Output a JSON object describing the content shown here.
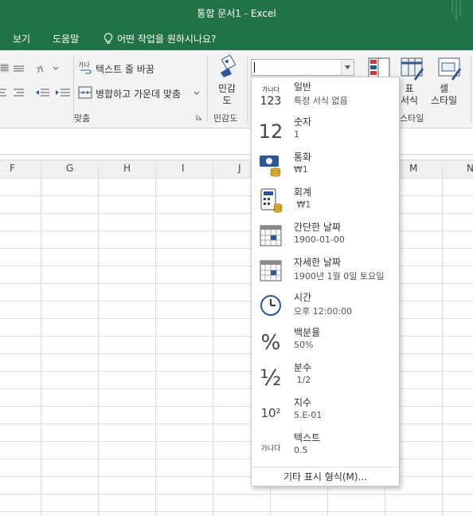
{
  "window": {
    "title": "통합 문서1  -  Excel"
  },
  "menu": {
    "items": [
      "보기",
      "도움말"
    ],
    "tell_me": "어떤 작업을 원하시나요?"
  },
  "ribbon": {
    "wrap_text": "텍스트 줄 바꿈",
    "merge_center": "병합하고 가운데 맞춤",
    "alignment_group": "맞춤",
    "sensitivity_label": "민감\n도",
    "sensitivity_group": "민감도",
    "table_format": "표\n서식",
    "cell_style": "셀\n스타일",
    "style_group": "스타일",
    "number_format_value": ""
  },
  "columns": [
    "F",
    "G",
    "H",
    "I",
    "J",
    "M",
    "N"
  ],
  "formats": [
    {
      "name": "일반",
      "example": "특정 서식 없음",
      "icon": "general-icon",
      "icon_text": "123",
      "icon_small": "가나다"
    },
    {
      "name": "숫자",
      "example": "1",
      "icon": "number-icon",
      "icon_text": "12"
    },
    {
      "name": "통화",
      "example": "₩1",
      "icon": "currency-icon"
    },
    {
      "name": "회계",
      "example": " ₩1",
      "icon": "accounting-icon"
    },
    {
      "name": "간단한 날짜",
      "example": "1900-01-00",
      "icon": "short-date-icon"
    },
    {
      "name": "자세한 날짜",
      "example": "1900년 1월 0일 토요일",
      "icon": "long-date-icon"
    },
    {
      "name": "시간",
      "example": "오후 12:00:00",
      "icon": "clock-icon"
    },
    {
      "name": "백분율",
      "example": "50%",
      "icon": "percent-icon",
      "icon_text": "%"
    },
    {
      "name": "분수",
      "example": " 1/2",
      "icon": "fraction-icon",
      "icon_text": "½"
    },
    {
      "name": "지수",
      "example": "5.E-01",
      "icon": "scientific-icon",
      "icon_text": "10²"
    },
    {
      "name": "텍스트",
      "example": "0.5",
      "icon": "text-icon",
      "icon_text": "가나다"
    }
  ],
  "more_formats": "기타 표시 형식(M)...",
  "colors": {
    "excel_green": "#217346",
    "ribbon_bg": "#f3f3f3",
    "grid": "#e1e1e1",
    "accent_blue": "#2b579a"
  }
}
